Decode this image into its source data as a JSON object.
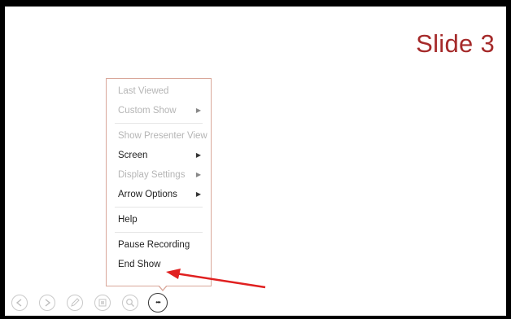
{
  "slide": {
    "title": "Slide 3"
  },
  "menu": {
    "items": [
      {
        "label": "Last Viewed",
        "disabled": true,
        "submenu": false
      },
      {
        "label": "Custom Show",
        "disabled": true,
        "submenu": true
      },
      {
        "label": "Show Presenter View",
        "disabled": true,
        "submenu": false
      },
      {
        "label": "Screen",
        "disabled": false,
        "submenu": true
      },
      {
        "label": "Display Settings",
        "disabled": true,
        "submenu": true
      },
      {
        "label": "Arrow Options",
        "disabled": false,
        "submenu": true
      },
      {
        "label": "Help",
        "disabled": false,
        "submenu": false
      },
      {
        "label": "Pause Recording",
        "disabled": false,
        "submenu": false
      },
      {
        "label": "End Show",
        "disabled": false,
        "submenu": false
      }
    ],
    "submenu_glyph": "▶"
  },
  "toolbar": {
    "buttons": [
      {
        "icon": "previous-icon"
      },
      {
        "icon": "next-icon"
      },
      {
        "icon": "pen-icon"
      },
      {
        "icon": "slides-grid-icon"
      },
      {
        "icon": "zoom-icon"
      },
      {
        "icon": "more-options-icon",
        "glyph": "•••"
      }
    ]
  },
  "colors": {
    "title": "#a52a2a",
    "menu_border": "#d9a79a",
    "annotation_arrow": "#e02020"
  }
}
